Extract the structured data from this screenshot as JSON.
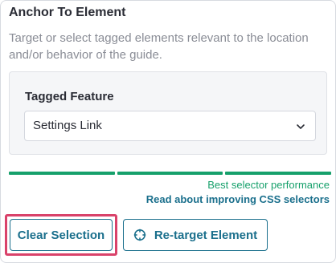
{
  "anchor": {
    "title": "Anchor To Element",
    "description": "Target or select tagged elements relevant to the location and/or behavior of the guide."
  },
  "tagged_feature": {
    "label": "Tagged Feature",
    "selected": "Settings Link",
    "chevron_icon": "chevron-down-icon"
  },
  "selector_meter": {
    "segments_filled": 3,
    "segments_total": 3,
    "status_text": "Best selector performance",
    "link_text": "Read about improving CSS selectors",
    "color": "#16a06b"
  },
  "actions": {
    "clear_label": "Clear Selection",
    "retarget_label": "Re-target Element",
    "retarget_icon": "crosshair-icon"
  },
  "colors": {
    "accent": "#1a6f8c",
    "success": "#16a06b",
    "highlight": "#d9426a"
  }
}
